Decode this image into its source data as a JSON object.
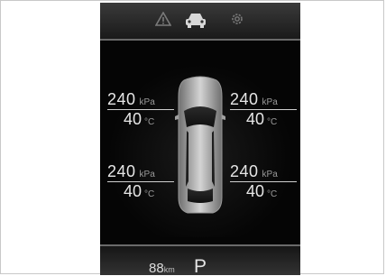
{
  "header": {
    "icons": [
      "warning-triangle-icon",
      "car-front-icon",
      "gear-icon"
    ]
  },
  "tires": {
    "front_left": {
      "pressure": "240",
      "pressure_unit": "kPa",
      "temperature": "40",
      "temp_unit": "°C"
    },
    "front_right": {
      "pressure": "240",
      "pressure_unit": "kPa",
      "temperature": "40",
      "temp_unit": "°C"
    },
    "rear_left": {
      "pressure": "240",
      "pressure_unit": "kPa",
      "temperature": "40",
      "temp_unit": "°C"
    },
    "rear_right": {
      "pressure": "240",
      "pressure_unit": "kPa",
      "temperature": "40",
      "temp_unit": "°C"
    }
  },
  "footer": {
    "odometer": "88",
    "odometer_unit": "km",
    "gear": "P"
  },
  "colors": {
    "screen_bg": "#050505",
    "text": "#e6e6e6",
    "unit_text": "#9a9a9a"
  }
}
